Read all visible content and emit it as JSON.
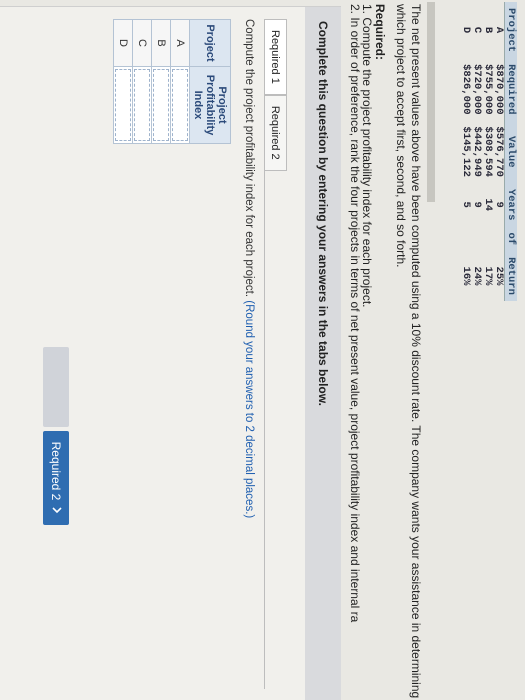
{
  "data_table": {
    "headers": [
      "Project",
      "Required",
      "Value",
      "Years",
      "of",
      "Return"
    ],
    "rows": [
      [
        "A",
        "$870,000",
        "$576,770",
        "9",
        "",
        "25%"
      ],
      [
        "B",
        "$755,000",
        "$308,594",
        "14",
        "",
        "17%"
      ],
      [
        "C",
        "$720,000",
        "$442,949",
        "9",
        "",
        "24%"
      ],
      [
        "D",
        "$826,000",
        "$145,122",
        "5",
        "",
        "16%"
      ]
    ]
  },
  "intro_text": "The net present values above have been computed using a 10% discount rate. The company wants your assistance in determining which project to accept first, second, and so forth.",
  "required": {
    "title": "Required:",
    "item1": "1. Compute the project profitability index for each project.",
    "item2": "2. In order of preference, rank the four projects in terms of net present value, project profitability index and internal ra"
  },
  "complete_header": "Complete this question by entering your answers in the tabs below.",
  "tabs": {
    "tab1": "Required 1",
    "tab2": "Required 2"
  },
  "instruction": {
    "main": "Compute the project profitability index for each project.",
    "note": "(Round your answers to 2 decimal places.)"
  },
  "pi_table": {
    "col_project": "Project",
    "col_index": "Project Profitability Index",
    "rows": [
      "A",
      "B",
      "C",
      "D"
    ]
  },
  "nav": {
    "next_label": "Required 2",
    "next_icon": "chevron-right-icon"
  }
}
